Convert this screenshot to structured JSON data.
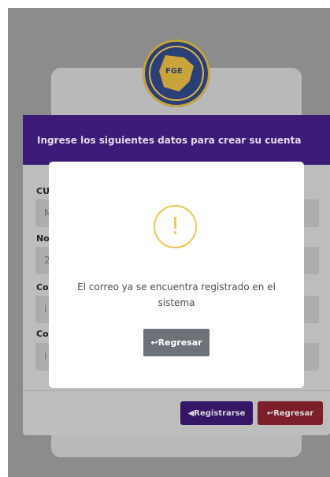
{
  "app": {
    "logo_lines": [
      "FISCALIA GENERAL",
      "FGE",
      "ESTADO DE CHIHUAHUA"
    ]
  },
  "form": {
    "title": "Ingrese los siguientes datos para crear su cuenta",
    "fields": [
      {
        "label": "CU",
        "value": "M"
      },
      {
        "label": "No",
        "value": "2"
      },
      {
        "label": "Co",
        "value": "i"
      },
      {
        "label": "Co",
        "value": "i"
      }
    ],
    "buttons": {
      "register": "Registrarse",
      "back": "Regresar"
    }
  },
  "modal": {
    "icon": "!",
    "message": "El correo ya se encuentra registrado en el sistema",
    "button": "Regresar"
  }
}
